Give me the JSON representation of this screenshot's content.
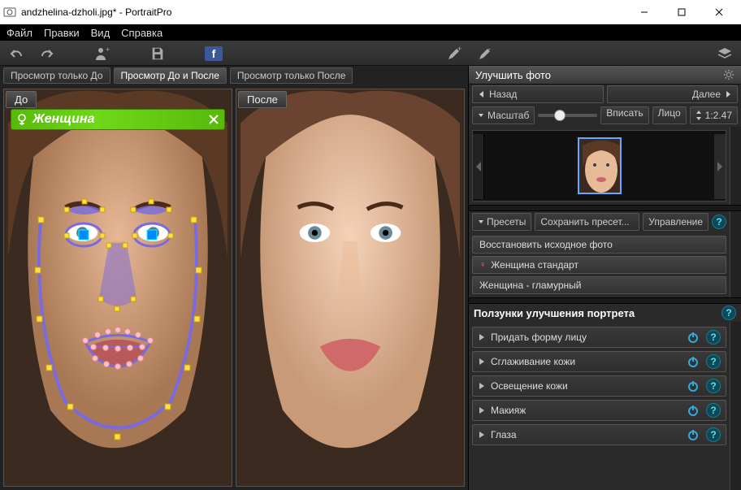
{
  "window": {
    "title": "andzhelina-dzholi.jpg* - PortraitPro"
  },
  "menu": {
    "file": "Файл",
    "edit": "Правки",
    "view": "Вид",
    "help": "Справка"
  },
  "toolbar": {
    "fb": "f"
  },
  "viewtabs": {
    "before_only": "Просмотр только До",
    "before_after": "Просмотр До и После",
    "after_only": "Просмотр только После"
  },
  "panes": {
    "before": "До",
    "after": "После"
  },
  "gender_tag": {
    "label": "Женщина"
  },
  "right": {
    "header": "Улучшить фото",
    "back": "Назад",
    "next": "Далее",
    "zoom_label": "Масштаб",
    "fit": "Вписать",
    "face": "Лицо",
    "ratio": "1:2.47",
    "presets_label": "Пресеты",
    "save_preset": "Сохранить пресет...",
    "manage": "Управление",
    "presets": [
      "Восстановить исходное фото",
      "Женщина стандарт",
      "Женщина - гламурный"
    ],
    "sliders_header": "Ползунки улучшения портрета",
    "sliders": [
      "Придать форму лицу",
      "Сглаживание кожи",
      "Освещение кожи",
      "Макияж",
      "Глаза"
    ]
  }
}
